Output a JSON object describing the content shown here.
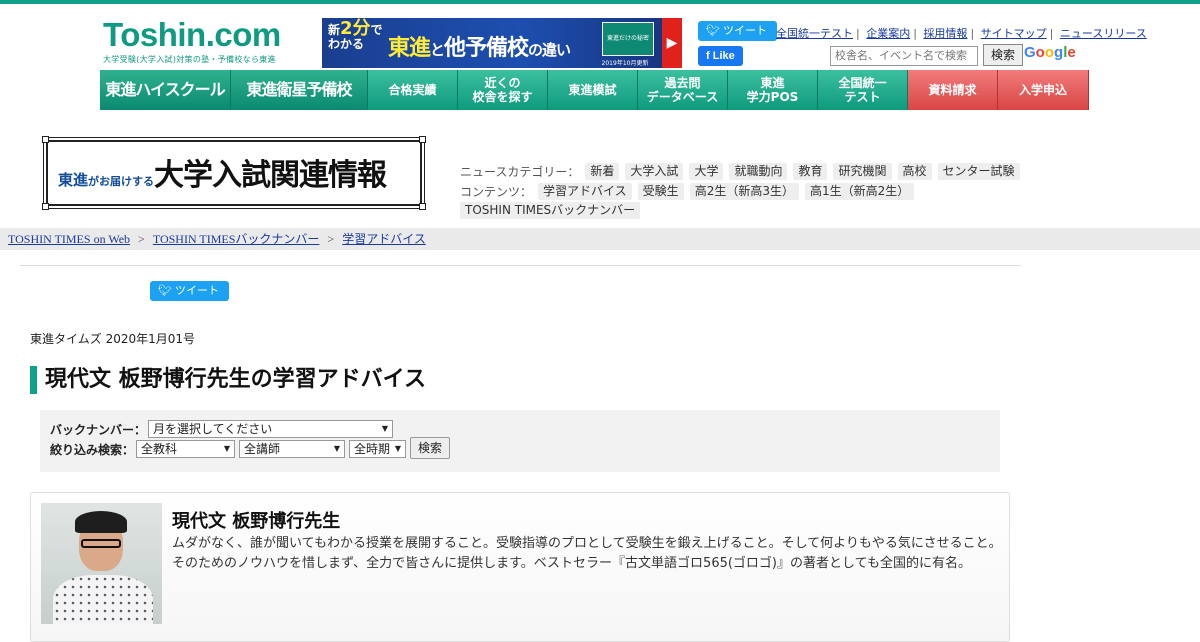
{
  "header": {
    "logo": "Toshin.com",
    "logo_sub": "大学受験(大学入試)対策の塾・予備校なら東進",
    "banner": {
      "left_top": "新",
      "left_big": "2分",
      "left_mid": "で",
      "left_bottom": "わかる",
      "main_1": "東進",
      "main_2": "と",
      "main_3": "他予備校",
      "main_4": "の違い",
      "pic_text": "東進だけの秘密",
      "date_text": "2019年10月更新",
      "arrow": "▶"
    },
    "tweet_label": "ツイート",
    "fb_label": "Like",
    "links": [
      "全国統一テスト",
      "企業案内",
      "採用情報",
      "サイトマップ",
      "ニュースリリース"
    ],
    "search_placeholder": "校舎名、イベント名で検索",
    "search_button": "検索",
    "google": "Google"
  },
  "nav": [
    {
      "label": "東進ハイスクール",
      "type": "brand"
    },
    {
      "label": "東進衛星予備校",
      "type": "brand"
    },
    {
      "label": "合格実績",
      "type": "normal"
    },
    {
      "label": "近くの\n校舎を探す",
      "type": "normal"
    },
    {
      "label": "東進模試",
      "type": "normal"
    },
    {
      "label": "過去問\nデータベース",
      "type": "normal"
    },
    {
      "label": "東進\n学力POS",
      "type": "normal"
    },
    {
      "label": "全国統一\nテスト",
      "type": "normal"
    },
    {
      "label": "資料請求",
      "type": "red"
    },
    {
      "label": "入学申込",
      "type": "red"
    }
  ],
  "site_title": {
    "t1": "東進",
    "t2": "がお届けする",
    "t3": "大学入試関連",
    "t4": "情報"
  },
  "categories": {
    "news_label": "ニュースカテゴリー：",
    "news": [
      "新着",
      "大学入試",
      "大学",
      "就職動向",
      "教育",
      "研究機関",
      "高校",
      "センター試験"
    ],
    "contents_label": "コンテンツ：",
    "contents": [
      "学習アドバイス",
      "受験生",
      "高2生（新高3生）",
      "高1生（新高2生）",
      "TOSHIN TIMESバックナンバー"
    ]
  },
  "breadcrumb": [
    "TOSHIN TIMES on Web",
    "TOSHIN TIMESバックナンバー",
    "学習アドバイス"
  ],
  "breadcrumb_sep": ">",
  "article": {
    "tweet_label": "ツイート",
    "date": "東進タイムズ 2020年1月01号",
    "title": "現代文 板野博行先生の学習アドバイス"
  },
  "filter": {
    "backnumber_label": "バックナンバー：",
    "backnumber_value": "月を選択してください",
    "search_label": "絞り込み検索：",
    "subject": "全教科",
    "teacher": "全講師",
    "period": "全時期",
    "button": "検索"
  },
  "teacher": {
    "name": "現代文 板野博行先生",
    "description": "ムダがなく、誰が聞いてもわかる授業を展開すること。受験指導のプロとして受験生を鍛え上げること。そして何よりもやる気にさせること。そのためのノウハウを惜しまず、全力で皆さんに提供します。ベストセラー『古文単語ゴロ565(ゴロゴ)』の著者としても全国的に有名。"
  }
}
